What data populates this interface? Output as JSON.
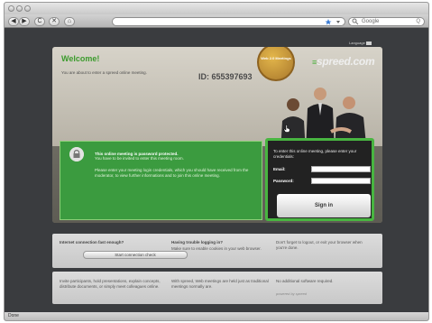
{
  "browser": {
    "search_placeholder": "Google",
    "buttons": {
      "back": "◀",
      "forward": "▶",
      "reload": "C",
      "stop": "✕",
      "home": "⌂"
    },
    "status_text": "Done"
  },
  "page": {
    "language_link": "Language",
    "welcome_title": "Welcome!",
    "enter_notice": "You are about to enter a spreed online meeting.",
    "meeting_id": "ID: 655397693",
    "badge_text": "Web 2.0 Meetings",
    "logo_text": "spreed.com",
    "protected_title": "This online meeting is password protected.",
    "invite_notice": "You have to be invited to enter this meeting room.",
    "credentials_notice": "Please enter your meeting login credentials, which you should have received from the moderator, to view further informations and to join this online meeting.",
    "login": {
      "intro": "To enter this online meeting, please enter your credentials:",
      "email_label": "Email:",
      "password_label": "Password:",
      "signin_label": "Sign in"
    },
    "info1": {
      "connection_title": "Internet connection fast enough?",
      "connection_button": "Start connection check",
      "trouble_title": "Having trouble logging in?",
      "trouble_text": "Make sure to enable cookies in your web browser.",
      "logout_text": "Don't forget to logout, or exit your browser when you're done."
    },
    "info2": {
      "participants_text": "Invite participants, hold presentations, explain concepts, distribute documents, or simply meet colleagues online.",
      "easier_text": "With spreed, Web meetings are held just as traditional meetings normally are.",
      "software_text": "No additional software required.",
      "powered_text": "powered by spreed"
    }
  },
  "colors": {
    "accent_green": "#3b9b3f",
    "title_green": "#3b9b2c",
    "login_border": "#48b541"
  }
}
